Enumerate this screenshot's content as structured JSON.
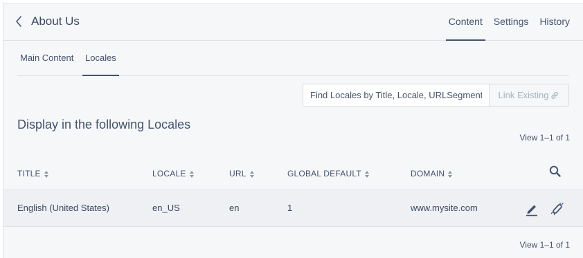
{
  "header": {
    "title": "About Us",
    "tabs": [
      {
        "label": "Content",
        "active": true
      },
      {
        "label": "Settings",
        "active": false
      },
      {
        "label": "History",
        "active": false
      }
    ]
  },
  "sub_tabs": [
    {
      "label": "Main Content",
      "active": false
    },
    {
      "label": "Locales",
      "active": true
    }
  ],
  "search": {
    "placeholder": "Find Locales by Title, Locale, URLSegment, Domain",
    "link_existing_label": "Link Existing"
  },
  "section": {
    "title": "Display in the following Locales",
    "view_count_top": "View 1–1 of 1",
    "view_count_bottom": "View 1–1 of 1"
  },
  "table": {
    "columns": [
      "TITLE",
      "LOCALE",
      "URL",
      "GLOBAL DEFAULT",
      "DOMAIN"
    ],
    "rows": [
      {
        "title": "English (United States)",
        "locale": "en_US",
        "url": "en",
        "global_default": "1",
        "domain": "www.mysite.com"
      }
    ]
  },
  "icons": {
    "back": "chevron-left-icon",
    "link": "link-icon",
    "sort": "sort-icon",
    "search": "search-icon",
    "edit": "pencil-icon",
    "unlink": "unlink-icon"
  },
  "colors": {
    "text": "#43536d",
    "muted": "#a7b1bf",
    "background": "#f6f7f9",
    "row_background": "#eef0f3",
    "border": "#dfe3e8"
  }
}
